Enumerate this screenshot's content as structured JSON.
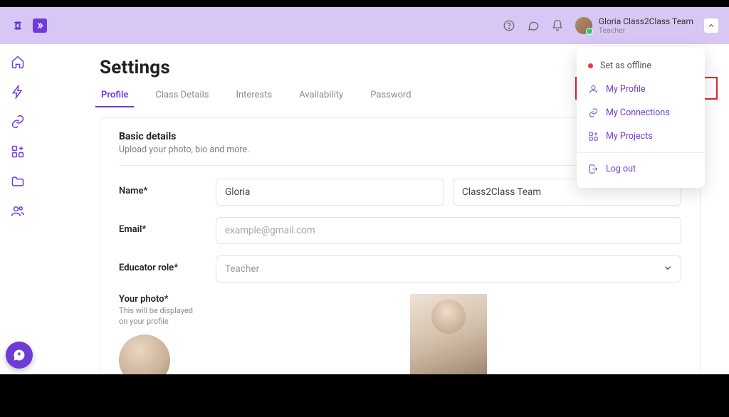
{
  "user": {
    "name": "Gloria Class2Class Team",
    "role": "Teacher"
  },
  "page": {
    "title": "Settings"
  },
  "tabs": [
    {
      "label": "Profile",
      "active": true
    },
    {
      "label": "Class Details"
    },
    {
      "label": "Interests"
    },
    {
      "label": "Availability"
    },
    {
      "label": "Password"
    }
  ],
  "section": {
    "title": "Basic details",
    "subtitle": "Upload your photo, bio and more."
  },
  "form": {
    "name_label": "Name*",
    "first_name_value": "Gloria",
    "last_name_value": "Class2Class Team",
    "email_label": "Email*",
    "email_placeholder": "example@gmail.com",
    "role_label": "Educator role*",
    "role_value": "Teacher",
    "photo_label": "Your photo*",
    "photo_hint": "This will be displayed on your profile"
  },
  "menu": {
    "offline": "Set as offline",
    "profile": "My Profile",
    "connections": "My Connections",
    "projects": "My Projects",
    "logout": "Log out"
  }
}
